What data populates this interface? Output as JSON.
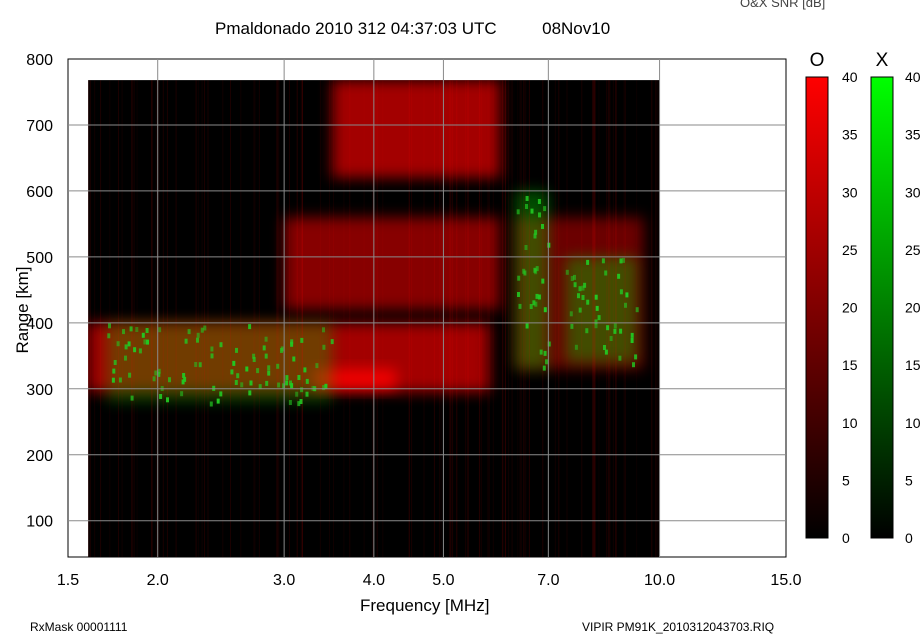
{
  "chart_data": {
    "type": "heatmap",
    "title": "Pmaldonado 2010 312 04:37:03 UTC",
    "date": "08Nov10",
    "xlabel": "Frequency [MHz]",
    "ylabel": "Range [km]",
    "x_scale": "log",
    "xlim": [
      1.5,
      15.0
    ],
    "ylim": [
      45,
      800
    ],
    "x_ticks": [
      "1.5",
      "2.0",
      "3.0",
      "4.0",
      "5.0",
      "7.0",
      "10.0",
      "15.0"
    ],
    "y_ticks": [
      "100",
      "200",
      "300",
      "400",
      "500",
      "600",
      "700",
      "800"
    ],
    "grid": true,
    "data_extent": {
      "x": [
        1.6,
        10.0
      ],
      "y": [
        45,
        768
      ]
    },
    "colorbar_title": "O&X SNR [dB]",
    "colorbars": [
      {
        "name": "O",
        "color": "#ff0000",
        "min": 0,
        "max": 40,
        "ticks": [
          "0",
          "5",
          "10",
          "15",
          "20",
          "25",
          "30",
          "35",
          "40"
        ]
      },
      {
        "name": "X",
        "color": "#00ff00",
        "min": 0,
        "max": 40,
        "ticks": [
          "0",
          "5",
          "10",
          "15",
          "20",
          "25",
          "30",
          "35",
          "40"
        ]
      }
    ],
    "echo_regions": [
      {
        "trace": "O",
        "f_range": [
          1.6,
          5.8
        ],
        "range_km": [
          295,
          400
        ],
        "snr_db": 30
      },
      {
        "trace": "O",
        "f_range": [
          3.3,
          4.3
        ],
        "range_km": [
          300,
          330
        ],
        "snr_db": 40
      },
      {
        "trace": "O",
        "f_range": [
          3.0,
          6.0
        ],
        "range_km": [
          420,
          560
        ],
        "snr_db": 25
      },
      {
        "trace": "O",
        "f_range": [
          3.5,
          6.0
        ],
        "range_km": [
          620,
          768
        ],
        "snr_db": 30
      },
      {
        "trace": "O",
        "f_range": [
          6.3,
          9.5
        ],
        "range_km": [
          330,
          560
        ],
        "snr_db": 20
      },
      {
        "trace": "X",
        "f_range": [
          1.7,
          3.5
        ],
        "range_km": [
          280,
          400
        ],
        "snr_db": 20
      },
      {
        "trace": "X",
        "f_range": [
          6.3,
          7.0
        ],
        "range_km": [
          330,
          600
        ],
        "snr_db": 25
      },
      {
        "trace": "X",
        "f_range": [
          7.4,
          9.3
        ],
        "range_km": [
          340,
          500
        ],
        "snr_db": 25
      }
    ]
  },
  "footer": {
    "left": "RxMask 00001111",
    "right": "VIPIR  PM91K_2010312043703.RIQ"
  }
}
